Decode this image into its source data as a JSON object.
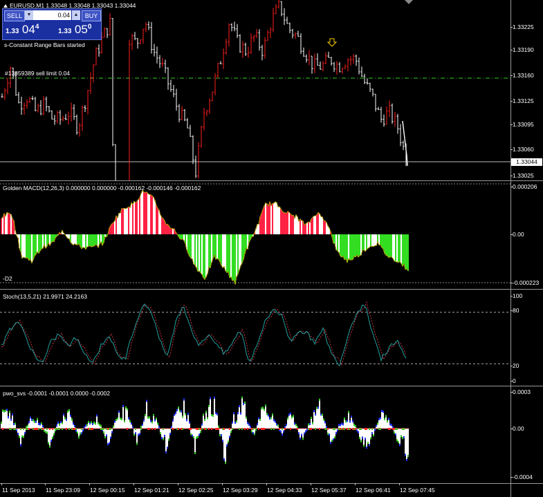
{
  "window": {
    "symbol_line": "EURUSD,M1  1.33048 1.33048 1.33043 1.33044",
    "current_price": "1.33044"
  },
  "trade_panel": {
    "sell_label": "SELL",
    "buy_label": "BUY",
    "lot_value": "0.04",
    "bid_prefix": "1.33",
    "bid_big": "04",
    "bid_sup": "4",
    "ask_prefix": "1.33",
    "ask_big": "05",
    "ask_sup": "0"
  },
  "messages": {
    "status": "s-Constant Range Bars started",
    "order": "#13859389 sell limit 0.04"
  },
  "price_scale": [
    "1.33225",
    "1.33190",
    "1.33160",
    "1.33125",
    "1.33095",
    "1.33060",
    "1.33025"
  ],
  "macd": {
    "label": "Golden MACD(12,26,3) 0.000000 0.000000 -0.000162 -0.000146 -0.000162",
    "top": "0.000206",
    "zero": "0.00",
    "bottom": "-0.000223",
    "lower_label": "-D2"
  },
  "stoch": {
    "label": "Stoch(13,5,21) 21.9971 24.2163",
    "levels": [
      "100",
      "80",
      "20",
      "0"
    ]
  },
  "pwo": {
    "label": "pwo_svs -0.0001 -0.0001 0.0000 -0.0002",
    "levels": [
      "0.0003",
      "0.00",
      "-0.0004"
    ]
  },
  "time_axis": [
    "11 Sep 2013",
    "11 Sep 23:09",
    "12 Sep 00:15",
    "12 Sep 01:21",
    "12 Sep 02:25",
    "12 Sep 03:29",
    "12 Sep 04:33",
    "12 Sep 05:37",
    "12 Sep 06:41",
    "12 Sep 07:45"
  ],
  "colors": {
    "bull": "#ff1e1e",
    "bear": "#ffffff",
    "green": "#33cc22",
    "teal": "#20a0a0",
    "blue": "#2233ff",
    "panel": "#1a2fa0",
    "order_line": "#33cc22"
  },
  "chart_data": [
    {
      "type": "line",
      "title": "EURUSD,M1",
      "series": [
        {
          "values": [
            1.3312,
            1.3316,
            1.3311,
            1.3312,
            1.331,
            1.3311,
            1.3309,
            1.3309,
            1.331,
            1.3308,
            1.3312,
            1.3317,
            1.332,
            1.3322,
            1.3214,
            1.332,
            1.3319,
            1.3322,
            1.3318,
            1.3316,
            1.3313,
            1.331,
            1.3308,
            1.3302,
            1.331,
            1.3313,
            1.3317,
            1.3322,
            1.3319,
            1.3318,
            1.332,
            1.3318,
            1.3322,
            1.3324,
            1.3321,
            1.332,
            1.3318,
            1.3316,
            1.3316,
            1.3317,
            1.3316,
            1.3317,
            1.3317,
            1.3314,
            1.3312,
            1.3309,
            1.331,
            1.3308,
            1.3304
          ]
        }
      ],
      "ylim": [
        1.3302,
        1.3324
      ]
    },
    {
      "type": "bar",
      "title": "Golden MACD(12,26,3)",
      "series": [
        {
          "values": [
            8e-05,
            0.0001,
            -0.0001,
            -0.00012,
            -6e-05,
            -4e-05,
            2e-05,
            -4e-05,
            -6e-05,
            -6e-05,
            -4e-05,
            6e-05,
            0.00012,
            0.00014,
            0.0002,
            0.00016,
            6e-05,
            2e-05,
            -4e-05,
            -0.00014,
            -0.0002,
            -0.0001,
            -0.00016,
            -0.00022,
            -8e-05,
            2e-05,
            0.00014,
            0.00014,
            0.0001,
            8e-05,
            4e-05,
            0.0001,
            6e-05,
            -8e-05,
            -0.00012,
            -0.0001,
            -6e-05,
            -4e-05,
            -0.0001,
            -0.00012,
            -0.00016
          ]
        }
      ],
      "ylim": [
        -0.000223,
        0.000206
      ]
    },
    {
      "type": "line",
      "title": "Stoch(13,5,21)",
      "series": [
        {
          "values": [
            40,
            60,
            70,
            50,
            30,
            20,
            45,
            55,
            40,
            50,
            35,
            20,
            40,
            55,
            30,
            25,
            60,
            88,
            85,
            55,
            25,
            65,
            90,
            60,
            40,
            55,
            45,
            30,
            45,
            60,
            20,
            45,
            70,
            85,
            75,
            45,
            60,
            55,
            45,
            60,
            30,
            20,
            55,
            80,
            90,
            55,
            25,
            40,
            45,
            25
          ]
        }
      ],
      "ylim": [
        0,
        100
      ]
    },
    {
      "type": "bar",
      "title": "pwo_svs",
      "series": [
        {
          "values": [
            0.0001,
            0.00012,
            -0.0001,
            8e-05,
            5e-05,
            -0.0001,
            6e-05,
            0.0001,
            -5e-05,
            4e-05,
            8e-05,
            -0.00012,
            0.0001,
            0.00014,
            -0.0001,
            0.00016,
            6e-05,
            -0.00014,
            0.00012,
            0.0002,
            -0.0002,
            0.00012,
            0.00022,
            -0.00025,
            8e-05,
            0.00018,
            -6e-05,
            0.00014,
            8e-05,
            -4e-05,
            0.00012,
            -8e-05,
            6e-05,
            0.00018,
            -0.00012,
            4e-05,
            0.0001,
            -6e-05,
            -0.00014,
            0.0001,
            8e-05,
            -0.0001,
            -0.0002
          ]
        }
      ],
      "ylim": [
        -0.0004,
        0.0003
      ]
    }
  ]
}
